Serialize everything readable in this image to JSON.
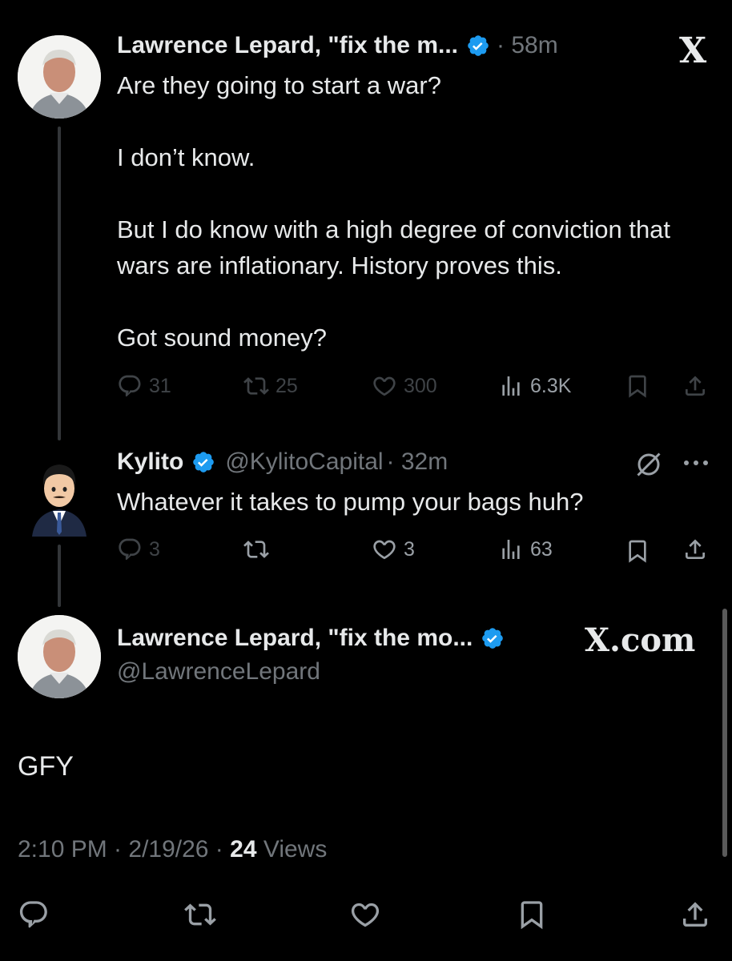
{
  "colors": {
    "background": "#000000",
    "verified_blue": "#1d9bf0",
    "muted": "#71767b",
    "text": "#e7e9ea"
  },
  "top_right_logo": "X",
  "tweet1": {
    "author_name": "Lawrence Lepard, \"fix the m...",
    "time": "· 58m",
    "text": "Are they going to start a war?\n\nI don’t know.\n\nBut I do know with a high degree of conviction that wars are inflationary. History proves this.\n\nGot sound money?",
    "replies": "31",
    "reposts": "25",
    "likes": "300",
    "views": "6.3K"
  },
  "tweet2": {
    "author_name": "Kylito",
    "handle": "@KylitoCapital",
    "time": "· 32m",
    "text": "Whatever it takes to pump your bags huh?",
    "replies": "3",
    "likes": "3",
    "views": "63"
  },
  "tweet3": {
    "author_name": "Lawrence Lepard, \"fix the mo...",
    "handle": "@LawrenceLepard",
    "watermark": "X.com",
    "text": "GFY",
    "time": "2:10 PM · 2/19/26 · ",
    "views_count": "24",
    "views_label": " Views"
  },
  "icons": [
    "reply-icon",
    "repost-icon",
    "like-icon",
    "views-icon",
    "bookmark-icon",
    "share-icon",
    "grok-icon",
    "more-icon",
    "verified-icon"
  ]
}
